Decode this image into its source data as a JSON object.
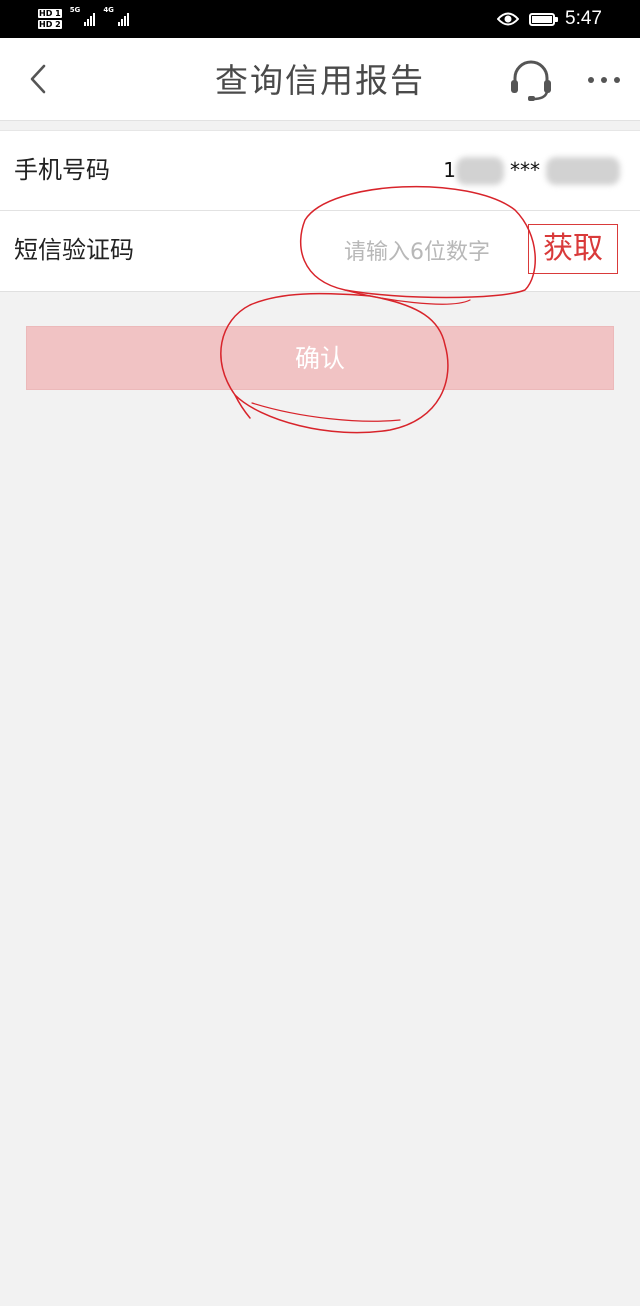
{
  "status_bar": {
    "sim1": "HD 1",
    "sim2": "HD 2",
    "network1": "5G",
    "network2": "4G",
    "time": "5:47",
    "icons": [
      "eye-icon",
      "battery-icon"
    ]
  },
  "navbar": {
    "title": "查询信用报告",
    "icons": [
      "back-chevron-icon",
      "customer-service-headset-icon",
      "more-dots-icon"
    ]
  },
  "form": {
    "phone_label": "手机号码",
    "phone_value_prefix": "1",
    "phone_value_masked": "***",
    "sms_label": "短信验证码",
    "sms_placeholder": "请输入6位数字",
    "sms_value": "",
    "get_code_button": "获取"
  },
  "confirm_button": "确认",
  "colors": {
    "accent_red": "#d93a3a",
    "confirm_disabled": "#f1c3c4",
    "page_bg": "#f2f2f2",
    "annotation_red": "#d8242b"
  }
}
